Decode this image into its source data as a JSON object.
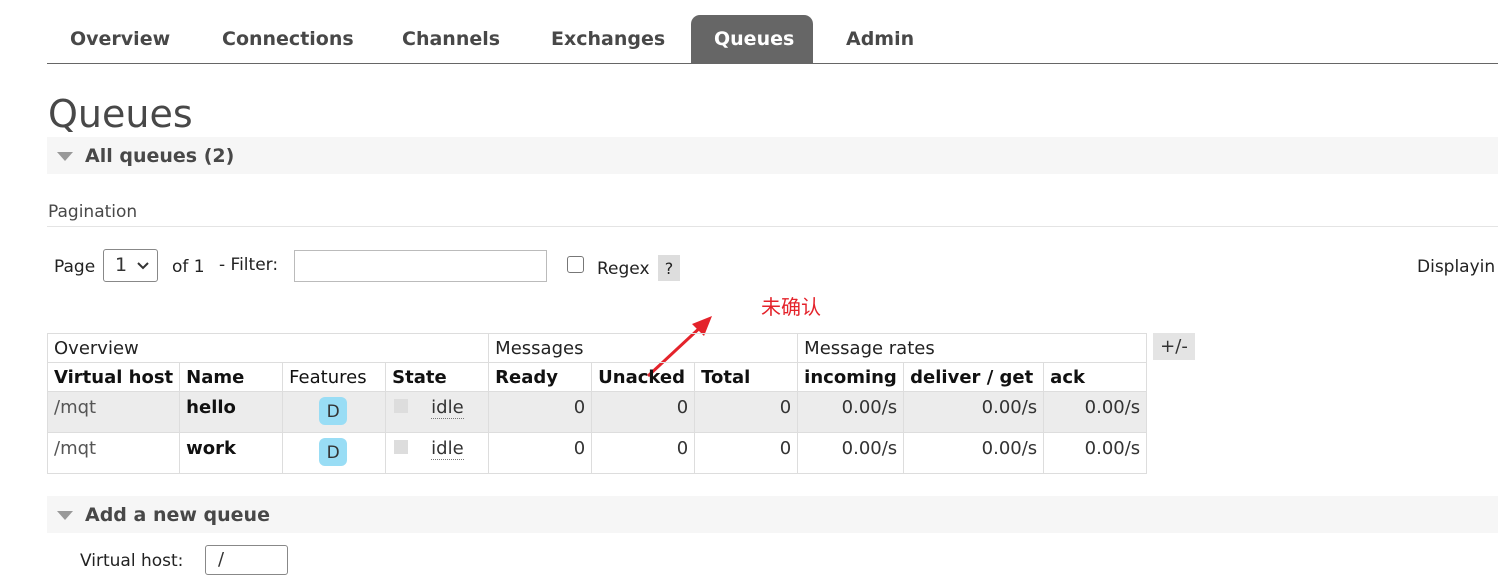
{
  "nav": {
    "tabs": [
      {
        "label": "Overview"
      },
      {
        "label": "Connections"
      },
      {
        "label": "Channels"
      },
      {
        "label": "Exchanges"
      },
      {
        "label": "Queues",
        "active": true
      },
      {
        "label": "Admin"
      }
    ]
  },
  "page_title": "Queues",
  "all_queues": {
    "label": "All queues (2)"
  },
  "pagination": {
    "label": "Pagination",
    "page_label": "Page",
    "page_value": "1",
    "of_label": "of 1",
    "filter_label": "- Filter:",
    "filter_value": "",
    "regex_label": "Regex",
    "regex_checked": false,
    "help": "?",
    "displaying": "Displayin"
  },
  "annotation": {
    "text": "未确认",
    "color": "#e4232b"
  },
  "table": {
    "groups": [
      "Overview",
      "Messages",
      "Message rates"
    ],
    "plus_minus": "+/-",
    "columns": [
      "Virtual host",
      "Name",
      "Features",
      "State",
      "Ready",
      "Unacked",
      "Total",
      "incoming",
      "deliver / get",
      "ack"
    ],
    "rows": [
      {
        "vhost": "/mqt",
        "name": "hello",
        "features": "D",
        "state": "idle",
        "ready": "0",
        "unacked": "0",
        "total": "0",
        "incoming": "0.00/s",
        "deliver_get": "0.00/s",
        "ack": "0.00/s"
      },
      {
        "vhost": "/mqt",
        "name": "work",
        "features": "D",
        "state": "idle",
        "ready": "0",
        "unacked": "0",
        "total": "0",
        "incoming": "0.00/s",
        "deliver_get": "0.00/s",
        "ack": "0.00/s"
      }
    ]
  },
  "add_queue": {
    "label": "Add a new queue",
    "virtual_host_label": "Virtual host:",
    "virtual_host_value": "/"
  },
  "colors": {
    "active_tab": "#666666",
    "badge": "#99ddf5",
    "annotation": "#e4232b"
  }
}
